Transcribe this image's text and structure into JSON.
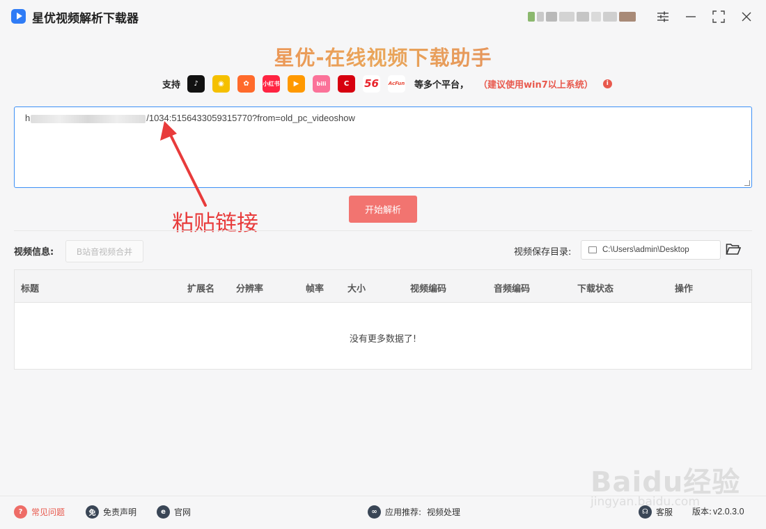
{
  "window": {
    "title": "星优视频解析下载器"
  },
  "header": {
    "title": "星优-在线视频下载助手",
    "support_label": "支持",
    "more_label": "等多个平台，",
    "note": "（建议使用win7以上系统）",
    "platforms": [
      {
        "icon": "douyin-icon",
        "glyph": "♪",
        "color": "#111111"
      },
      {
        "icon": "weibo-icon",
        "glyph": "◉",
        "color": "#f5c000"
      },
      {
        "icon": "kuaishou-icon",
        "glyph": "✿",
        "color": "#ff6a2b"
      },
      {
        "icon": "xiaohongshu-icon",
        "glyph": "小红书",
        "color": "#ff2442"
      },
      {
        "icon": "tencent-video-icon",
        "glyph": "▶",
        "color": "#ff9900"
      },
      {
        "icon": "bilibili-icon",
        "glyph": "bili",
        "color": "#fb7299"
      },
      {
        "icon": "cctv-icon",
        "glyph": "C",
        "color": "#d7000f"
      },
      {
        "icon": "56-icon",
        "glyph": "56",
        "color": "#ffffff"
      },
      {
        "icon": "acfun-icon",
        "glyph": "AcFun",
        "color": "#ffffff"
      }
    ]
  },
  "url_input": {
    "prefix": "h",
    "value": "/1034:5156433059315770?from=old_pc_videoshow"
  },
  "annotation": {
    "text": "粘贴链接"
  },
  "parse_button": {
    "label": "开始解析"
  },
  "info_row": {
    "video_info_label": "视频信息:",
    "merge_button": "B站音视频合并",
    "save_dir_label": "视频保存目录:",
    "save_dir_value": "C:\\Users\\admin\\Desktop"
  },
  "table": {
    "columns": [
      "标题",
      "扩展名",
      "分辨率",
      "帧率",
      "大小",
      "视频编码",
      "音频编码",
      "下载状态",
      "操作"
    ],
    "rows": [],
    "empty_text": "没有更多数据了!"
  },
  "footer": {
    "faq": "常见问题",
    "disclaimer": "免责声明",
    "website": "官网",
    "recommend_label": "应用推荐:",
    "recommend_value": "视频处理",
    "service": "客服",
    "version_label": "版本:",
    "version_value": "v2.0.3.0"
  },
  "watermark": {
    "main": "Baidu经验",
    "sub": "jingyan.baidu.com"
  }
}
